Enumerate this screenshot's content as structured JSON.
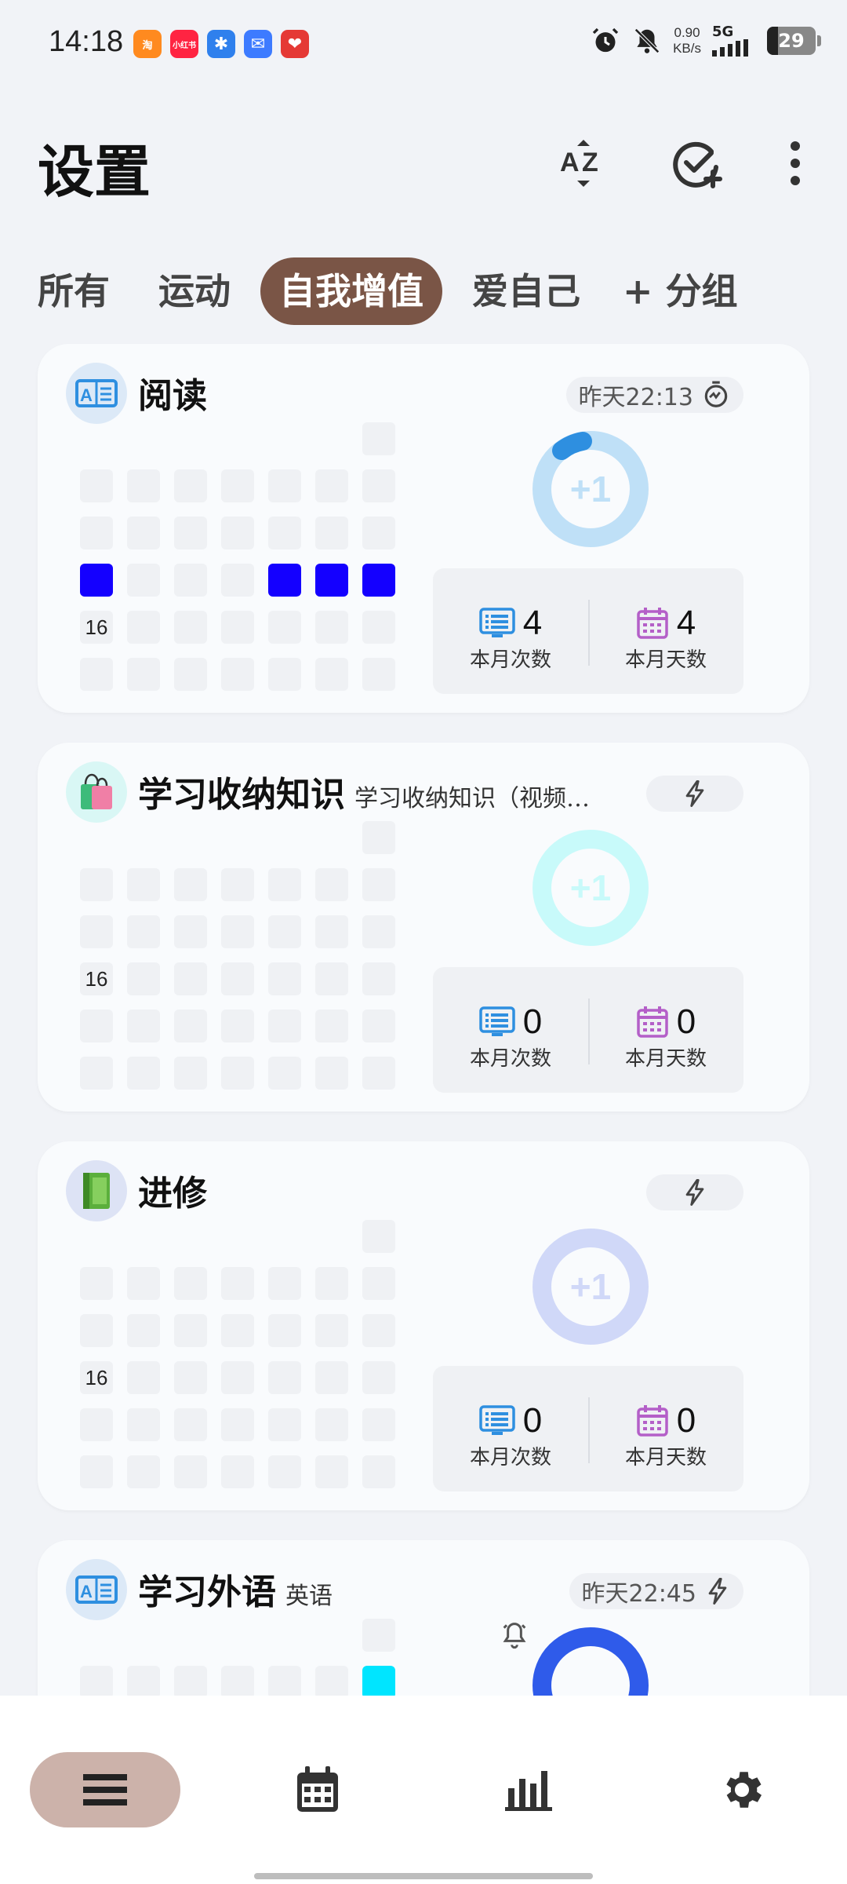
{
  "status_bar": {
    "time": "14:18",
    "apps": [
      {
        "name": "taobao-app-icon",
        "color": "#FF8A1F",
        "label": "淘"
      },
      {
        "name": "xiaohongshu-app-icon",
        "color": "#FF2442",
        "label": "小红书"
      },
      {
        "name": "star-app-icon",
        "color": "#2F80ED",
        "label": "✱"
      },
      {
        "name": "mail-app-icon",
        "color": "#3D7BFF",
        "label": "✉"
      },
      {
        "name": "heart-app-icon",
        "color": "#E53935",
        "label": "❤"
      }
    ],
    "net_speed": "0.90",
    "net_unit": "KB/s",
    "signal_type": "5G",
    "battery": "29"
  },
  "header": {
    "title": "设置",
    "sort_icon": "sort-az-icon",
    "add_check_icon": "add-check-icon",
    "more_icon": "more-vert-icon"
  },
  "tabs": [
    {
      "label": "所有",
      "active": false
    },
    {
      "label": "运动",
      "active": false
    },
    {
      "label": "自我增值",
      "active": true
    },
    {
      "label": "爱自己",
      "active": false
    },
    {
      "label": "+ 分组",
      "active": false
    }
  ],
  "cards": [
    {
      "title": "阅读",
      "subtitle": "",
      "icon": "book-icon",
      "icon_bg": "#DCE9F7",
      "pill_text": "昨天22:13",
      "pill_icon": "timer-icon",
      "row_label": "16",
      "ring_color": "#BFE0F7",
      "ring_accent": "#2E8FE0",
      "ring_text": "+1",
      "count_value": "4",
      "count_label": "本月次数",
      "days_value": "4",
      "days_label": "本月天数",
      "active_cells": [
        [
          2,
          0
        ],
        [
          2,
          4
        ],
        [
          2,
          5
        ],
        [
          2,
          6
        ]
      ]
    },
    {
      "title": "学习收纳知识",
      "subtitle": "学习收纳知识（视频…",
      "icon": "shopping-bag-icon",
      "icon_bg": "#D9F7F5",
      "pill_text": "",
      "pill_icon": "bolt-icon",
      "row_label": "16",
      "ring_color": "#C8FAFA",
      "ring_accent": "",
      "ring_text": "+1",
      "count_value": "0",
      "count_label": "本月次数",
      "days_value": "0",
      "days_label": "本月天数",
      "active_cells": []
    },
    {
      "title": "进修",
      "subtitle": "",
      "icon": "green-book-icon",
      "icon_bg": "#DDE3F5",
      "pill_text": "",
      "pill_icon": "bolt-icon",
      "row_label": "16",
      "ring_color": "#D0D8F8",
      "ring_accent": "",
      "ring_text": "+1",
      "count_value": "0",
      "count_label": "本月次数",
      "days_value": "0",
      "days_label": "本月天数",
      "active_cells": []
    },
    {
      "title": "学习外语",
      "subtitle": "英语",
      "icon": "book-icon",
      "icon_bg": "#DCE9F7",
      "pill_text": "昨天22:45",
      "pill_icon": "bolt-icon",
      "row_label": "",
      "ring_color": "#2F5BEA",
      "ring_accent": "",
      "ring_text": "✓",
      "count_value": "",
      "count_label": "",
      "days_value": "",
      "days_label": "",
      "active_cells": []
    }
  ],
  "bottom_nav": [
    {
      "icon": "list-icon",
      "active": true
    },
    {
      "icon": "calendar-icon",
      "active": false
    },
    {
      "icon": "bar-chart-icon",
      "active": false
    },
    {
      "icon": "settings-gear-icon",
      "active": false
    }
  ],
  "colors": {
    "tab_active": "#7A5546",
    "nav_active": "#CCB2AA",
    "heat_on": "#1400FF",
    "heat_cyan": "#00E5FF"
  }
}
